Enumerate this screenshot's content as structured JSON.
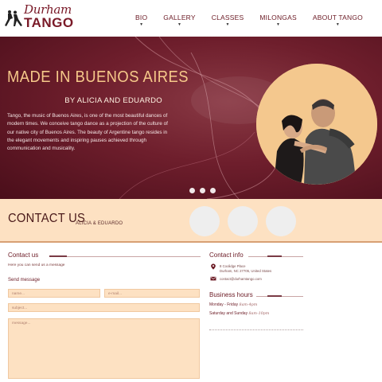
{
  "brand": {
    "script": "Durham",
    "main": "TANGO",
    "accent": "#7a1a28"
  },
  "nav": [
    {
      "label": "BIO"
    },
    {
      "label": "GALLERY"
    },
    {
      "label": "CLASSES"
    },
    {
      "label": "MILONGAS"
    },
    {
      "label": "ABOUT TANGO"
    }
  ],
  "hero": {
    "title": "MADE IN BUENOS AIRES",
    "subtitle": "BY ALICIA AND EDUARDO",
    "body": "Tango, the music of Buenos Aires, is one of the most beautiful dances of modern times. We conceive tango dance as a projection of the culture of our native city of Buenos Aires. The beauty of Argentine tango resides in the elegant movements and inspiring pauses achieved through communication and musicality.",
    "slide_count": 3
  },
  "contact_band": {
    "title": "CONTACT US",
    "subtitle": "ALICIA & EDUARDO"
  },
  "contact_form": {
    "title": "Contact us",
    "intro": "Here you can send us a message",
    "send_label": "Send message",
    "name_placeholder": "name...",
    "email_placeholder": "e-mail...",
    "subject_placeholder": "subject...",
    "message_placeholder": "message..."
  },
  "contact_info": {
    "title": "Contact info",
    "address_line1": "8 Coolidge Place",
    "address_line2": "Durham, NC 27705, United States",
    "email": "contact@durhamtango.com"
  },
  "business_hours": {
    "title": "Business hours",
    "rows": [
      {
        "days": "Monday - Friday",
        "time": "8am-4pm"
      },
      {
        "days": "Saturday and Sunday",
        "time": "8am-10pm"
      }
    ]
  }
}
